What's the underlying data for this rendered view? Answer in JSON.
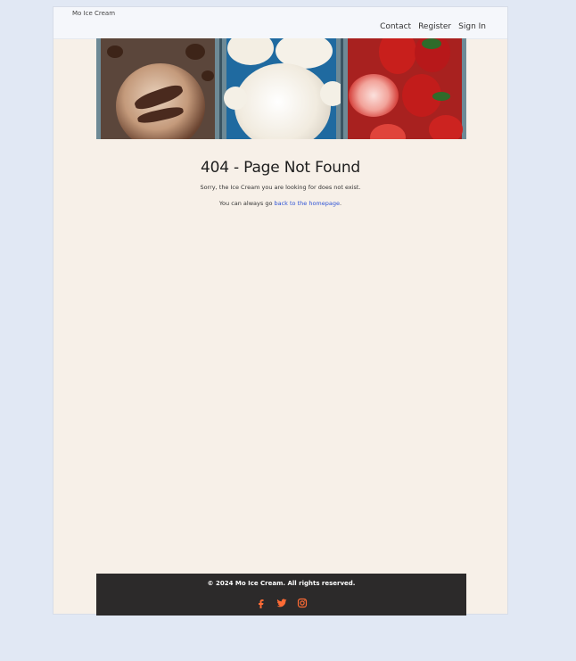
{
  "header": {
    "brand": "Mo Ice Cream",
    "nav": [
      "Contact",
      "Register",
      "Sign In"
    ]
  },
  "main": {
    "title": "404 - Page Not Found",
    "message": "Sorry, the Ice Cream you are looking for does not exist.",
    "back_prefix": "You can always go ",
    "back_link": "back to the homepage",
    "back_suffix": "."
  },
  "footer": {
    "copyright": "© 2024 Mo Ice Cream. All rights reserved.",
    "socials": [
      "facebook-icon",
      "twitter-icon",
      "instagram-icon"
    ],
    "accent_color": "#ff6b35"
  }
}
